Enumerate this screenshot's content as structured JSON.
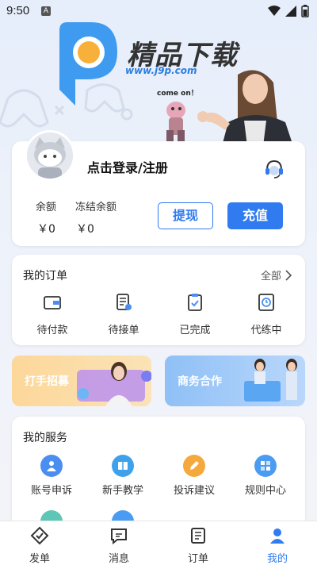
{
  "status_bar": {
    "time": "9:50",
    "notif_badge": "A"
  },
  "banner": {
    "brand_title": "精品下载",
    "brand_url": "www.j9p.com",
    "come_on": "come on！"
  },
  "profile": {
    "login_label": "点击登录/注册",
    "balance_label": "余额",
    "balance_value": "￥0",
    "frozen_label": "冻结余额",
    "frozen_value": "￥0",
    "withdraw_label": "提现",
    "recharge_label": "充值"
  },
  "orders": {
    "title": "我的订单",
    "all_label": "全部",
    "items": [
      {
        "label": "待付款",
        "icon": "wallet-icon"
      },
      {
        "label": "待接单",
        "icon": "document-icon"
      },
      {
        "label": "已完成",
        "icon": "clipboard-check-icon"
      },
      {
        "label": "代练中",
        "icon": "clock-icon"
      }
    ]
  },
  "promos": {
    "left_label": "打手招募",
    "right_label": "商务合作"
  },
  "services": {
    "title": "我的服务",
    "items": [
      {
        "label": "账号申诉",
        "icon": "account-icon",
        "color": "#4a8ff0"
      },
      {
        "label": "新手教学",
        "icon": "book-icon",
        "color": "#3ea2ea"
      },
      {
        "label": "投诉建议",
        "icon": "pencil-icon",
        "color": "#f5a93c"
      },
      {
        "label": "规则中心",
        "icon": "rules-icon",
        "color": "#4a9cf2"
      }
    ]
  },
  "bottom_nav": {
    "items": [
      {
        "label": "发单",
        "icon": "send-order-icon"
      },
      {
        "label": "消息",
        "icon": "message-icon"
      },
      {
        "label": "订单",
        "icon": "order-list-icon"
      },
      {
        "label": "我的",
        "icon": "user-icon"
      }
    ],
    "active_color": "#2f7bef"
  }
}
